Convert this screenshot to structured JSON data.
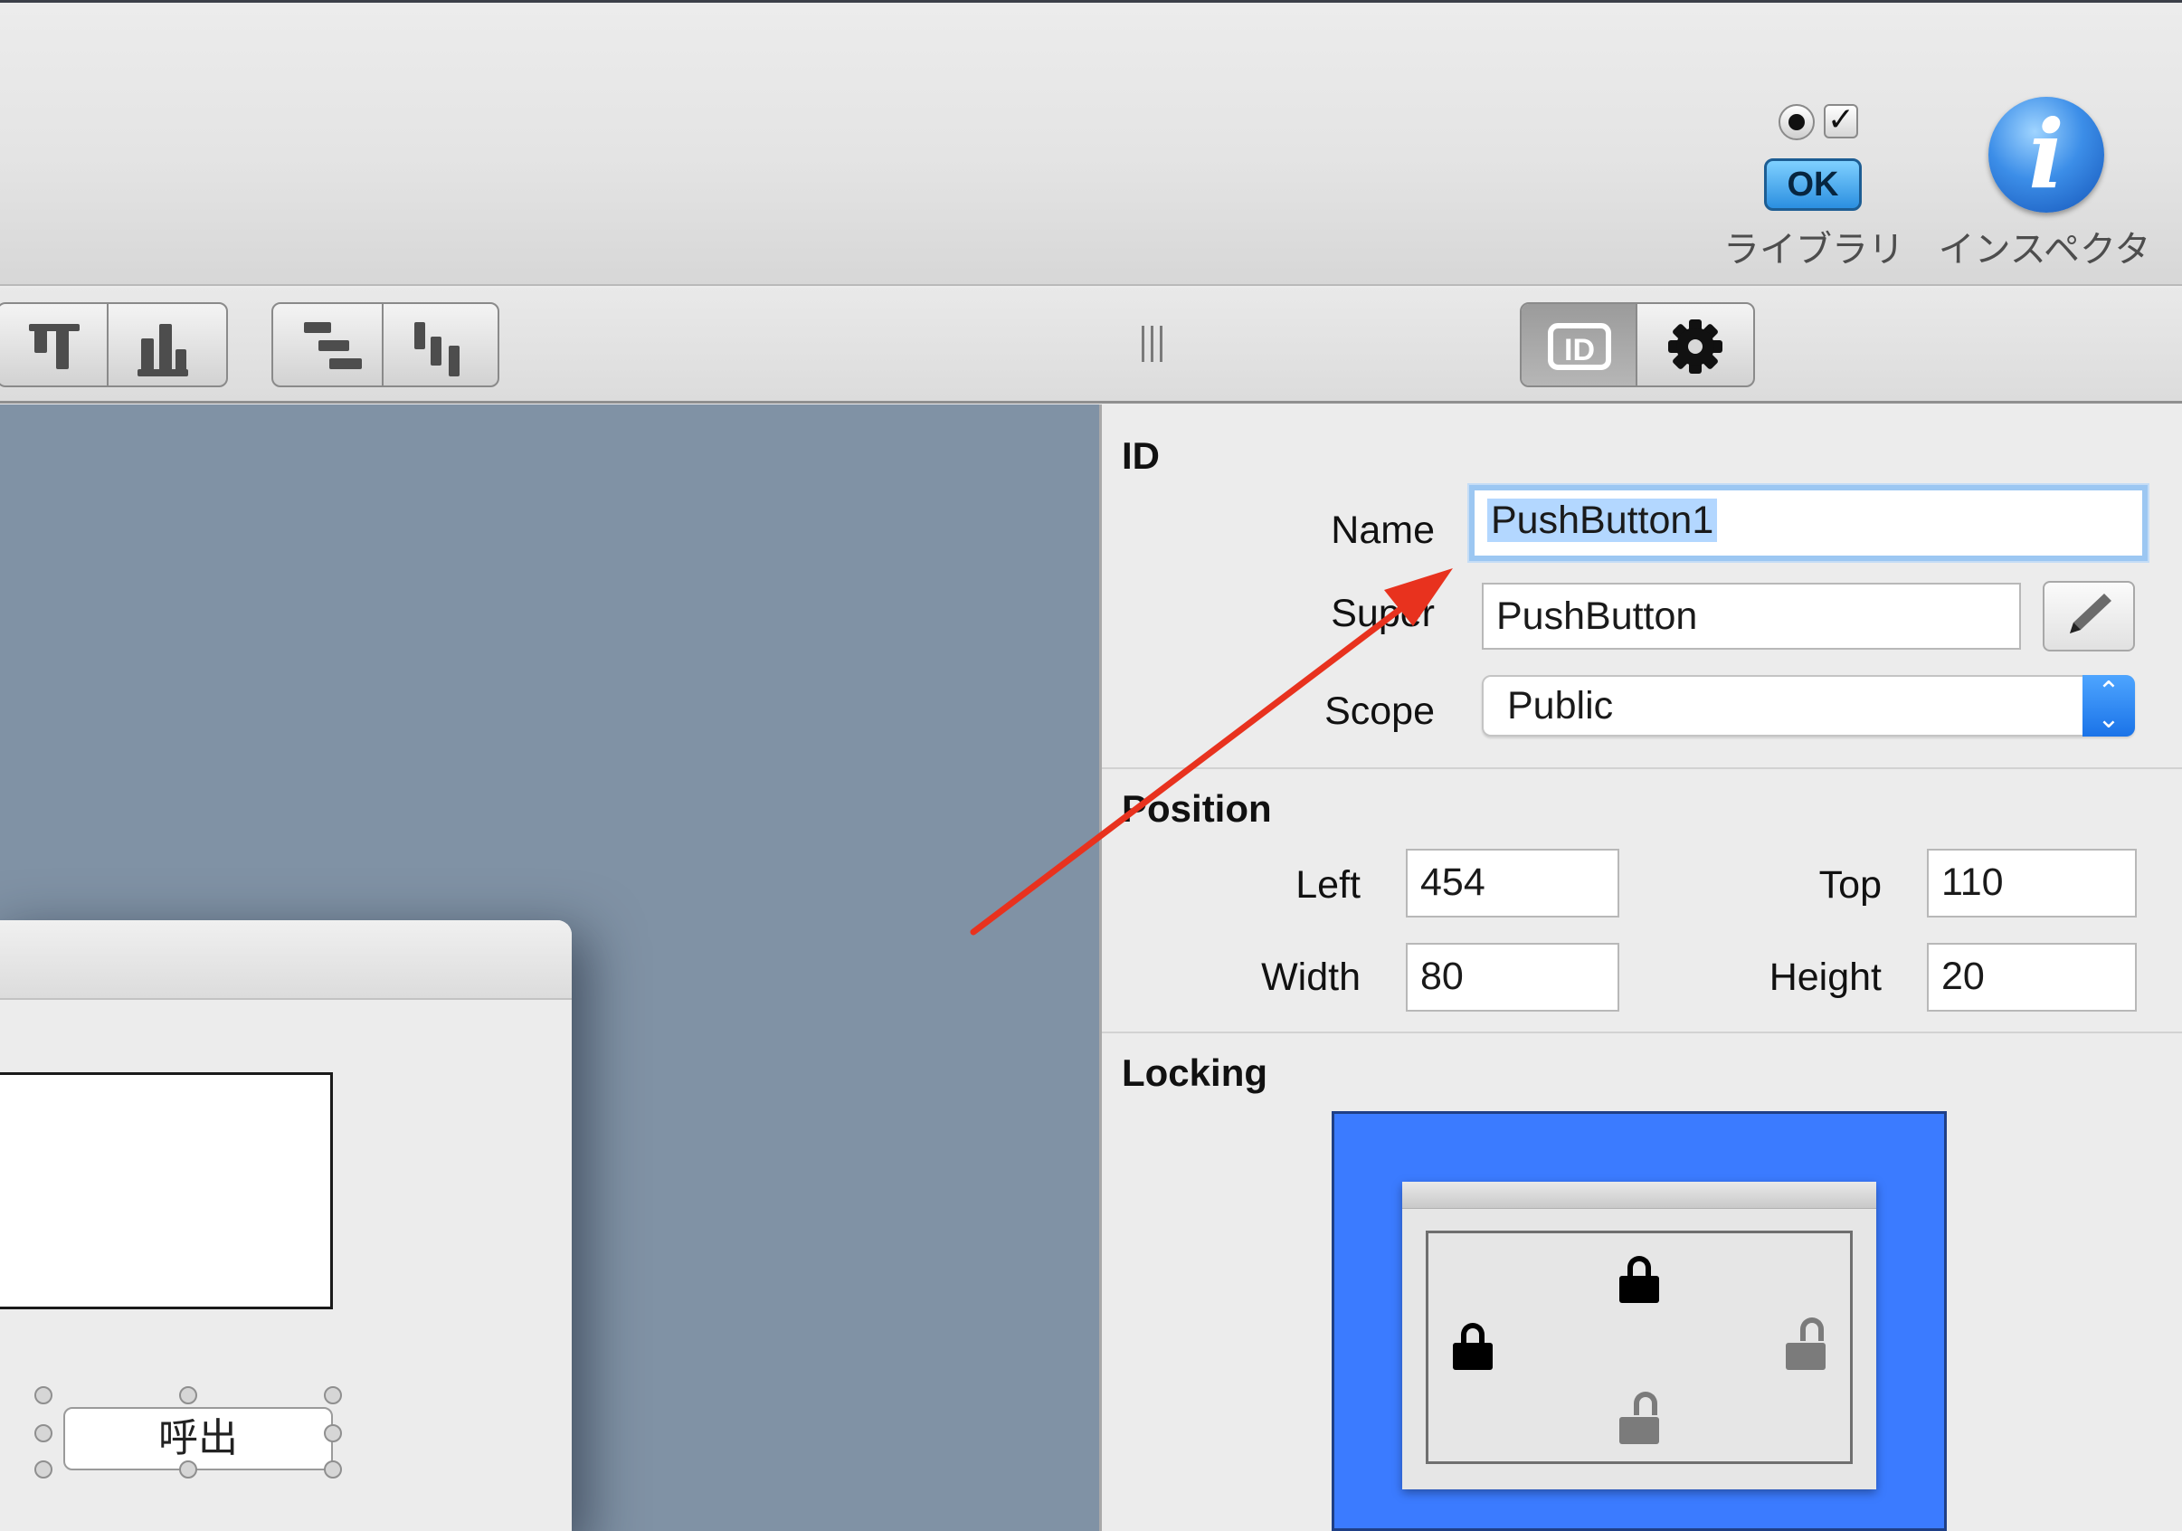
{
  "toolbar": {
    "library_label": "ライブラリ",
    "library_ok_text": "OK",
    "inspector_label": "インスペクタ",
    "inspector_icon_glyph": "i",
    "library_check_glyph": "✓"
  },
  "inspector_tabs": {
    "id_tab_label": "ID"
  },
  "design_canvas": {
    "push_button_label": "呼出"
  },
  "id_section": {
    "title": "ID",
    "name_label": "Name",
    "name_value": "PushButton1",
    "super_label": "Super",
    "super_value": "PushButton",
    "scope_label": "Scope",
    "scope_value": "Public",
    "scope_arrows": "⌃⌄"
  },
  "position_section": {
    "title": "Position",
    "left_label": "Left",
    "left_value": "454",
    "top_label": "Top",
    "top_value": "110",
    "width_label": "Width",
    "width_value": "80",
    "height_label": "Height",
    "height_value": "20"
  },
  "locking_section": {
    "title": "Locking",
    "locks": {
      "top": "locked",
      "left": "locked",
      "right": "unlocked",
      "bottom": "unlocked"
    }
  },
  "colors": {
    "canvas": "#8092a5",
    "lock_background": "#3b7bff",
    "annotation_arrow": "#e8321e",
    "focus_ring": "#9cc7f2"
  }
}
